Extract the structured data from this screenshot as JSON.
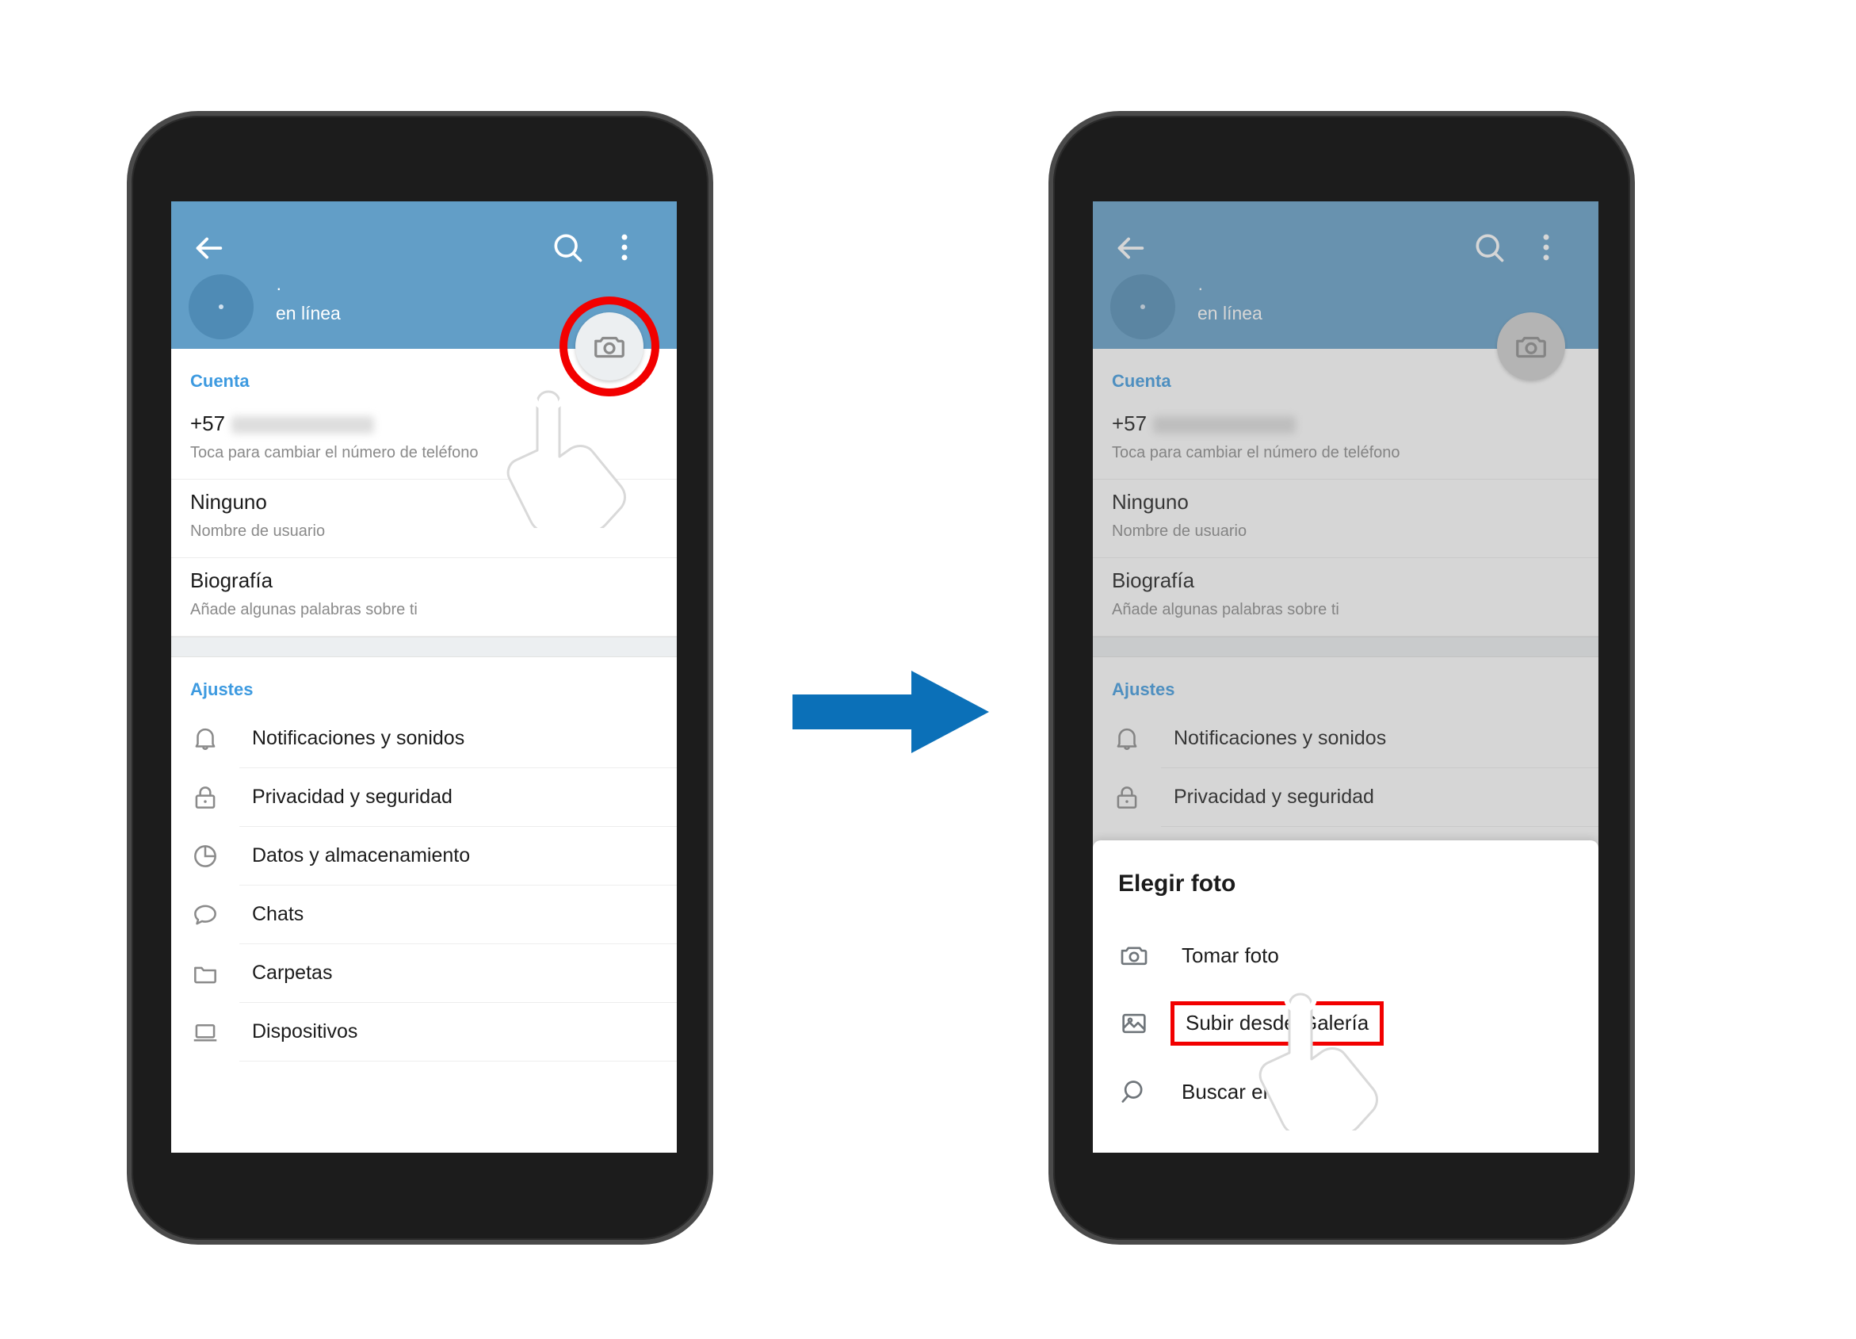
{
  "flow": {
    "arrow_color": "#0b70b8",
    "highlight_color": "#f20000",
    "accent_color": "#3d9ae0",
    "header_color": "#629ec7"
  },
  "app": {
    "header": {
      "back_icon": "arrow-left-icon",
      "search_icon": "search-icon",
      "more_icon": "overflow-menu-icon",
      "profile_name": "·",
      "status": "en línea",
      "camera_fab_icon": "camera-icon"
    },
    "account": {
      "section_label": "Cuenta",
      "rows": [
        {
          "primary": "+57",
          "secondary": "Toca para cambiar el número de teléfono",
          "masked": true
        },
        {
          "primary": "Ninguno",
          "secondary": "Nombre de usuario",
          "masked": false
        },
        {
          "primary": "Biografía",
          "secondary": "Añade algunas palabras sobre ti",
          "masked": false
        }
      ]
    },
    "settings": {
      "section_label": "Ajustes",
      "items": [
        {
          "label": "Notificaciones y sonidos",
          "icon": "bell-icon"
        },
        {
          "label": "Privacidad y seguridad",
          "icon": "lock-icon"
        },
        {
          "label": "Datos y almacenamiento",
          "icon": "pie-chart-icon"
        },
        {
          "label": "Chats",
          "icon": "chat-bubble-icon"
        },
        {
          "label": "Carpetas",
          "icon": "folder-icon"
        },
        {
          "label": "Dispositivos",
          "icon": "laptop-icon"
        }
      ]
    }
  },
  "sheet": {
    "title": "Elegir foto",
    "options": [
      {
        "label": "Tomar foto",
        "icon": "camera-icon",
        "highlighted": false
      },
      {
        "label": "Subir desde Galería",
        "icon": "image-icon",
        "highlighted": true
      },
      {
        "label": "Buscar en la web",
        "icon": "search-icon",
        "highlighted": false
      }
    ]
  },
  "steps": {
    "step1_target": "camera-fab",
    "step2_target": "upload-from-gallery"
  }
}
